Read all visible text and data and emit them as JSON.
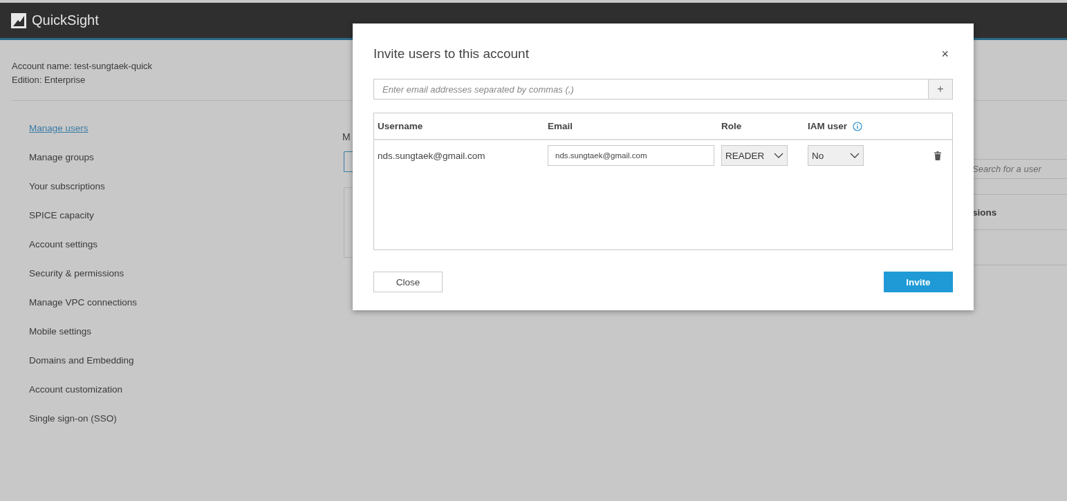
{
  "header": {
    "logo": "QuickSight"
  },
  "account": {
    "name_line": "Account name: test-sungtaek-quick",
    "edition_line": "Edition: Enterprise"
  },
  "sidebar": {
    "items": [
      {
        "label": "Manage users",
        "selected": true
      },
      {
        "label": "Manage groups",
        "selected": false
      },
      {
        "label": "Your subscriptions",
        "selected": false
      },
      {
        "label": "SPICE capacity",
        "selected": false
      },
      {
        "label": "Account settings",
        "selected": false
      },
      {
        "label": "Security & permissions",
        "selected": false
      },
      {
        "label": "Manage VPC connections",
        "selected": false
      },
      {
        "label": "Mobile settings",
        "selected": false
      },
      {
        "label": "Domains and Embedding",
        "selected": false
      },
      {
        "label": "Account customization",
        "selected": false
      },
      {
        "label": "Single sign-on (SSO)",
        "selected": false
      }
    ]
  },
  "background_page": {
    "heading": "M",
    "search": {
      "placeholder": "Search for a user"
    },
    "table_header": "sions"
  },
  "dialog": {
    "title": "Invite users to this account",
    "close": "×",
    "email_entry": {
      "placeholder": "Enter email addresses separated by commas (,)"
    },
    "add": "+",
    "table": {
      "columns": [
        "Username",
        "Email",
        "Role",
        "IAM user"
      ],
      "rows": [
        {
          "username": "nds.sungtaek@gmail.com",
          "email": "nds.sungtaek@gmail.com",
          "role": "READER",
          "iam_user": "No"
        }
      ]
    },
    "buttons": [
      {
        "label": "Close",
        "kind": "secondary"
      },
      {
        "label": "Invite",
        "kind": "primary"
      }
    ]
  }
}
